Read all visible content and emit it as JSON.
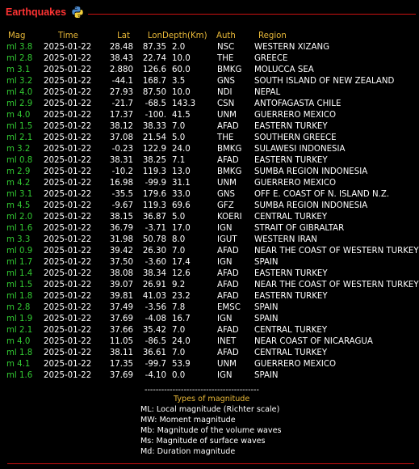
{
  "header": {
    "title": "Earthquakes",
    "icon": "python-logo-icon"
  },
  "columns": {
    "mag": "Mag",
    "time": "Time",
    "lat": "Lat",
    "lon": "Lon",
    "depth": "Depth(Km)",
    "auth": "Auth",
    "region": "Region"
  },
  "rows": [
    [
      "ml 3.8",
      "2025-01-22",
      "28.48",
      "87.35",
      "2.0",
      "NSC",
      "WESTERN XIZANG"
    ],
    [
      "ml 2.8",
      "2025-01-22",
      "38.43",
      "22.74",
      "10.0",
      "THE",
      "GREECE"
    ],
    [
      "m 3.1",
      "2025-01-22",
      "2.880",
      "126.6",
      "60.0",
      "BMKG",
      "MOLUCCA SEA"
    ],
    [
      "ml 3.2",
      "2025-01-22",
      "-44.1",
      "168.7",
      "3.5",
      "GNS",
      "SOUTH ISLAND OF NEW ZEALAND"
    ],
    [
      "ml 4.0",
      "2025-01-22",
      "27.93",
      "87.50",
      "10.0",
      "NDI",
      "NEPAL"
    ],
    [
      "ml 2.9",
      "2025-01-22",
      "-21.7",
      "-68.5",
      "143.3",
      "CSN",
      "ANTOFAGASTA CHILE"
    ],
    [
      "m 4.0",
      "2025-01-22",
      "17.37",
      "-100.",
      "41.5",
      "UNM",
      "GUERRERO MEXICO"
    ],
    [
      "ml 1.5",
      "2025-01-22",
      "38.12",
      "38.33",
      "7.0",
      "AFAD",
      "EASTERN TURKEY"
    ],
    [
      "ml 2.1",
      "2025-01-22",
      "37.08",
      "21.54",
      "5.0",
      "THE",
      "SOUTHERN GREECE"
    ],
    [
      "m 3.2",
      "2025-01-22",
      "-0.23",
      "122.9",
      "24.0",
      "BMKG",
      "SULAWESI INDONESIA"
    ],
    [
      "ml 0.8",
      "2025-01-22",
      "38.31",
      "38.25",
      "7.1",
      "AFAD",
      "EASTERN TURKEY"
    ],
    [
      "m 2.9",
      "2025-01-22",
      "-10.2",
      "119.3",
      "13.0",
      "BMKG",
      "SUMBA REGION INDONESIA"
    ],
    [
      "m 4.2",
      "2025-01-22",
      "16.98",
      "-99.9",
      "31.1",
      "UNM",
      "GUERRERO MEXICO"
    ],
    [
      "ml 3.1",
      "2025-01-22",
      "-35.5",
      "179.6",
      "33.0",
      "GNS",
      "OFF E. COAST OF N. ISLAND N.Z."
    ],
    [
      "m 4.5",
      "2025-01-22",
      "-9.67",
      "119.3",
      "69.6",
      "GFZ",
      "SUMBA REGION INDONESIA"
    ],
    [
      "ml 2.0",
      "2025-01-22",
      "38.15",
      "36.87",
      "5.0",
      "KOERI",
      "CENTRAL TURKEY"
    ],
    [
      "ml 1.6",
      "2025-01-22",
      "36.79",
      "-3.71",
      "17.0",
      "IGN",
      "STRAIT OF GIBRALTAR"
    ],
    [
      "m 3.3",
      "2025-01-22",
      "31.98",
      "50.78",
      "8.0",
      "IGUT",
      "WESTERN IRAN"
    ],
    [
      "ml 0.9",
      "2025-01-22",
      "39.42",
      "26.30",
      "7.0",
      "AFAD",
      "NEAR THE COAST OF WESTERN TURKEY"
    ],
    [
      "ml 1.7",
      "2025-01-22",
      "37.50",
      "-3.60",
      "17.4",
      "IGN",
      "SPAIN"
    ],
    [
      "ml 1.4",
      "2025-01-22",
      "38.08",
      "38.34",
      "12.6",
      "AFAD",
      "EASTERN TURKEY"
    ],
    [
      "ml 1.5",
      "2025-01-22",
      "39.07",
      "26.91",
      "9.2",
      "AFAD",
      "NEAR THE COAST OF WESTERN TURKEY"
    ],
    [
      "ml 1.8",
      "2025-01-22",
      "39.81",
      "41.03",
      "23.2",
      "AFAD",
      "EASTERN TURKEY"
    ],
    [
      "m 2.8",
      "2025-01-22",
      "37.49",
      "-3.56",
      "7.8",
      "EMSC",
      "SPAIN"
    ],
    [
      "ml 1.9",
      "2025-01-22",
      "37.69",
      "-4.08",
      "16.7",
      "IGN",
      "SPAIN"
    ],
    [
      "ml 2.1",
      "2025-01-22",
      "37.66",
      "35.42",
      "7.0",
      "AFAD",
      "CENTRAL TURKEY"
    ],
    [
      "m 4.0",
      "2025-01-22",
      "11.05",
      "-86.5",
      "24.0",
      "INET",
      "NEAR COAST OF NICARAGUA"
    ],
    [
      "ml 1.8",
      "2025-01-22",
      "38.11",
      "36.61",
      "7.0",
      "AFAD",
      "CENTRAL TURKEY"
    ],
    [
      "m 4.1",
      "2025-01-22",
      "17.35",
      "-99.7",
      "53.9",
      "UNM",
      "GUERRERO MEXICO"
    ],
    [
      "ml 1.6",
      "2025-01-22",
      "37.69",
      "-4.10",
      "0.0",
      "IGN",
      "SPAIN"
    ]
  ],
  "legend": {
    "separator": "-----------------------------------------",
    "title": "Types of magnitude",
    "items": [
      "ML: Local magnitude (Richter scale)",
      "MW: Moment magnitude",
      "Mb: Magnitude of the volume waves",
      "Ms: Magnitude of surface waves",
      "Md: Duration magnitude"
    ]
  },
  "colors": {
    "accent": "#ff3333",
    "header": "#e8b838",
    "magnitude": "#33cc33",
    "text": "#ffffff",
    "background": "#000000"
  }
}
